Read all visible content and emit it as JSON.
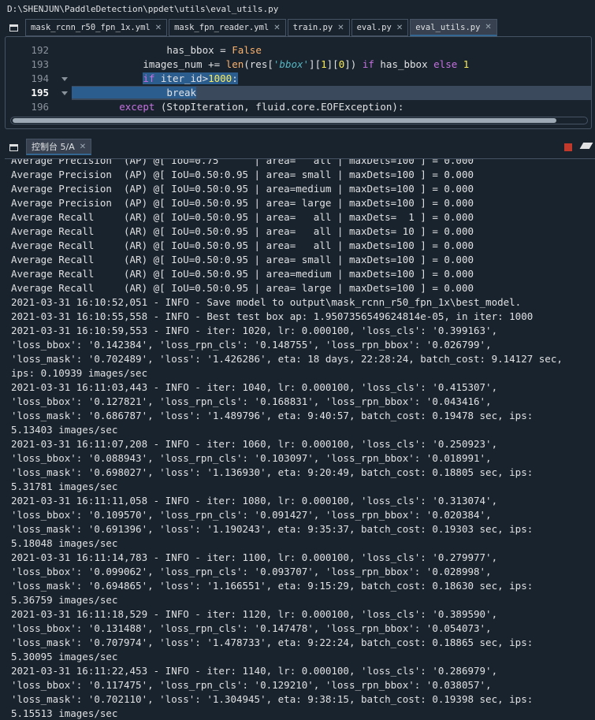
{
  "path": "D:\\SHENJUN\\PaddleDetection\\ppdet\\utils\\eval_utils.py",
  "tabs": [
    {
      "label": "mask_rcnn_r50_fpn_1x.yml",
      "active": false
    },
    {
      "label": "mask_fpn_reader.yml",
      "active": false
    },
    {
      "label": "train.py",
      "active": false
    },
    {
      "label": "eval.py",
      "active": false
    },
    {
      "label": "eval_utils.py",
      "active": true
    }
  ],
  "editor": {
    "line_numbers": [
      "192",
      "193",
      "194",
      "195",
      "196"
    ],
    "current_line": "195",
    "lines": {
      "l192": {
        "indent": "                ",
        "a": "has_bbox",
        "b": " = ",
        "c": "False"
      },
      "l193": {
        "indent": "            ",
        "a": "images_num += ",
        "b": "len",
        "c": "(res[",
        "d": "'bbox'",
        "e": "][",
        "f": "1",
        "g": "][",
        "h": "0",
        "i": "]) ",
        "j": "if",
        "k": " has_bbox ",
        "l": "else",
        "m": " ",
        "n": "1"
      },
      "l194": {
        "indent": "            ",
        "a": "if",
        "b": " iter_id>",
        "c": "1000",
        "d": ":"
      },
      "l195": {
        "indent": "                ",
        "a": "break"
      },
      "l196": {
        "indent": "        ",
        "a": "except",
        "b": " (StopIteration, fluid.core.EOFException):"
      }
    }
  },
  "console": {
    "tab_label": "控制台 5/A",
    "lines": [
      "Average Precision  (AP) @[ IoU=0.75      | area=   all | maxDets=100 ] = 0.000",
      "Average Precision  (AP) @[ IoU=0.50:0.95 | area= small | maxDets=100 ] = 0.000",
      "Average Precision  (AP) @[ IoU=0.50:0.95 | area=medium | maxDets=100 ] = 0.000",
      "Average Precision  (AP) @[ IoU=0.50:0.95 | area= large | maxDets=100 ] = 0.000",
      "Average Recall     (AR) @[ IoU=0.50:0.95 | area=   all | maxDets=  1 ] = 0.000",
      "Average Recall     (AR) @[ IoU=0.50:0.95 | area=   all | maxDets= 10 ] = 0.000",
      "Average Recall     (AR) @[ IoU=0.50:0.95 | area=   all | maxDets=100 ] = 0.000",
      "Average Recall     (AR) @[ IoU=0.50:0.95 | area= small | maxDets=100 ] = 0.000",
      "Average Recall     (AR) @[ IoU=0.50:0.95 | area=medium | maxDets=100 ] = 0.000",
      "Average Recall     (AR) @[ IoU=0.50:0.95 | area= large | maxDets=100 ] = 0.000",
      "2021-03-31 16:10:52,051 - INFO - Save model to output\\mask_rcnn_r50_fpn_1x\\best_model.",
      "2021-03-31 16:10:55,558 - INFO - Best test box ap: 1.9507356549624814e-05, in iter: 1000",
      "2021-03-31 16:10:59,553 - INFO - iter: 1020, lr: 0.000100, 'loss_cls': '0.399163',",
      "'loss_bbox': '0.142384', 'loss_rpn_cls': '0.148755', 'loss_rpn_bbox': '0.026799',",
      "'loss_mask': '0.702489', 'loss': '1.426286', eta: 18 days, 22:28:24, batch_cost: 9.14127 sec,",
      "ips: 0.10939 images/sec",
      "2021-03-31 16:11:03,443 - INFO - iter: 1040, lr: 0.000100, 'loss_cls': '0.415307',",
      "'loss_bbox': '0.127821', 'loss_rpn_cls': '0.168831', 'loss_rpn_bbox': '0.043416',",
      "'loss_mask': '0.686787', 'loss': '1.489796', eta: 9:40:57, batch_cost: 0.19478 sec, ips:",
      "5.13403 images/sec",
      "2021-03-31 16:11:07,208 - INFO - iter: 1060, lr: 0.000100, 'loss_cls': '0.250923',",
      "'loss_bbox': '0.088943', 'loss_rpn_cls': '0.103097', 'loss_rpn_bbox': '0.018991',",
      "'loss_mask': '0.698027', 'loss': '1.136930', eta: 9:20:49, batch_cost: 0.18805 sec, ips:",
      "5.31781 images/sec",
      "2021-03-31 16:11:11,058 - INFO - iter: 1080, lr: 0.000100, 'loss_cls': '0.313074',",
      "'loss_bbox': '0.109570', 'loss_rpn_cls': '0.091427', 'loss_rpn_bbox': '0.020384',",
      "'loss_mask': '0.691396', 'loss': '1.190243', eta: 9:35:37, batch_cost: 0.19303 sec, ips:",
      "5.18048 images/sec",
      "2021-03-31 16:11:14,783 - INFO - iter: 1100, lr: 0.000100, 'loss_cls': '0.279977',",
      "'loss_bbox': '0.099062', 'loss_rpn_cls': '0.093707', 'loss_rpn_bbox': '0.028998',",
      "'loss_mask': '0.694865', 'loss': '1.166551', eta: 9:15:29, batch_cost: 0.18630 sec, ips:",
      "5.36759 images/sec",
      "2021-03-31 16:11:18,529 - INFO - iter: 1120, lr: 0.000100, 'loss_cls': '0.389590',",
      "'loss_bbox': '0.131488', 'loss_rpn_cls': '0.147478', 'loss_rpn_bbox': '0.054073',",
      "'loss_mask': '0.707974', 'loss': '1.478733', eta: 9:22:24, batch_cost: 0.18865 sec, ips:",
      "5.30095 images/sec",
      "2021-03-31 16:11:22,453 - INFO - iter: 1140, lr: 0.000100, 'loss_cls': '0.286979',",
      "'loss_bbox': '0.117475', 'loss_rpn_cls': '0.129210', 'loss_rpn_bbox': '0.038057',",
      "'loss_mask': '0.702110', 'loss': '1.304945', eta: 9:38:15, batch_cost: 0.19398 sec, ips:",
      "5.15513 images/sec"
    ]
  },
  "colors": {
    "background": "#19232d",
    "keyword": "#c670e0",
    "builtin": "#fab16c",
    "number": "#faed5c",
    "string": "#56b6c2",
    "selection": "#2c5d8f",
    "stop": "#c0392b"
  }
}
